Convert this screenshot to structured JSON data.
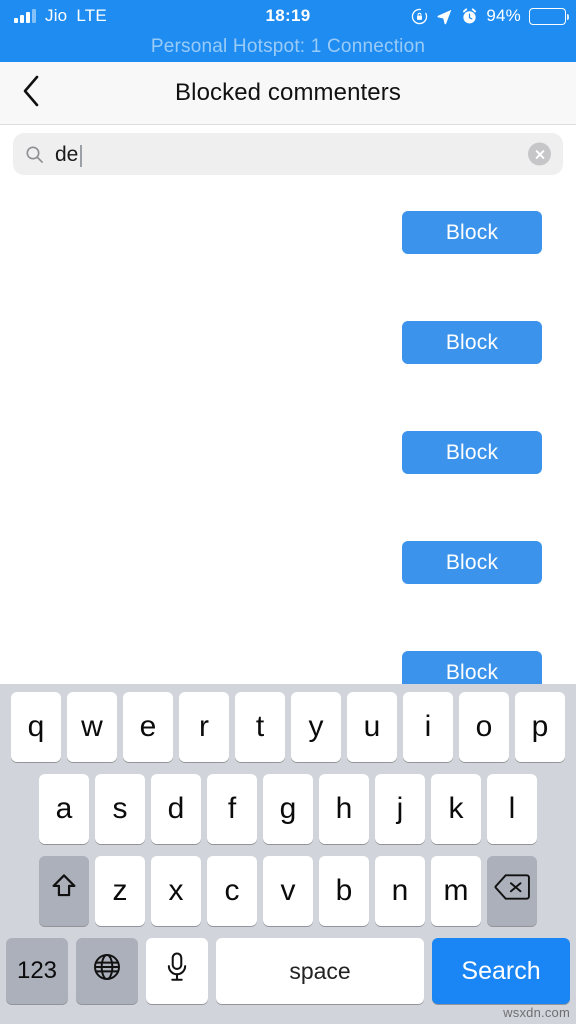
{
  "status_bar": {
    "carrier": "Jio",
    "network": "LTE",
    "time": "18:19",
    "battery_percent": "94%",
    "icons": {
      "signal": "signal-bars-icon",
      "rotation_lock": "rotation-lock-icon",
      "location": "location-arrow-icon",
      "alarm": "alarm-clock-icon",
      "battery": "battery-icon"
    },
    "colors": {
      "background": "#1e8cf0",
      "text": "#ffffff"
    }
  },
  "hotspot_banner": {
    "text": "Personal Hotspot: 1 Connection"
  },
  "nav_bar": {
    "back_icon": "chevron-left-icon",
    "title": "Blocked commenters"
  },
  "search": {
    "icon": "search-icon",
    "value": "de",
    "placeholder": "Search",
    "clear_icon": "clear-circle-icon"
  },
  "list": {
    "rows": [
      {
        "name": "",
        "subtitle": "",
        "block_label": "Block"
      },
      {
        "name": "",
        "subtitle": "",
        "block_label": "Block"
      },
      {
        "name": "",
        "subtitle": "",
        "block_label": "Block"
      },
      {
        "name": "",
        "subtitle": "",
        "block_label": "Block"
      },
      {
        "name": "",
        "subtitle": "",
        "block_label": "Block"
      }
    ],
    "block_color": "#3b93ec"
  },
  "keyboard": {
    "row1": [
      "q",
      "w",
      "e",
      "r",
      "t",
      "y",
      "u",
      "i",
      "o",
      "p"
    ],
    "row2": [
      "a",
      "s",
      "d",
      "f",
      "g",
      "h",
      "j",
      "k",
      "l"
    ],
    "row3": [
      "z",
      "x",
      "c",
      "v",
      "b",
      "n",
      "m"
    ],
    "shift_icon": "shift-arrow-icon",
    "delete_icon": "backspace-delete-icon",
    "numbers_label": "123",
    "globe_icon": "globe-icon",
    "mic_icon": "microphone-icon",
    "space_label": "space",
    "search_label": "Search",
    "colors": {
      "background": "#d1d5db",
      "key": "#ffffff",
      "modifier": "#abb0bb",
      "search_key": "#1a86f5"
    }
  },
  "watermark": {
    "text": "wsxdn.com"
  }
}
